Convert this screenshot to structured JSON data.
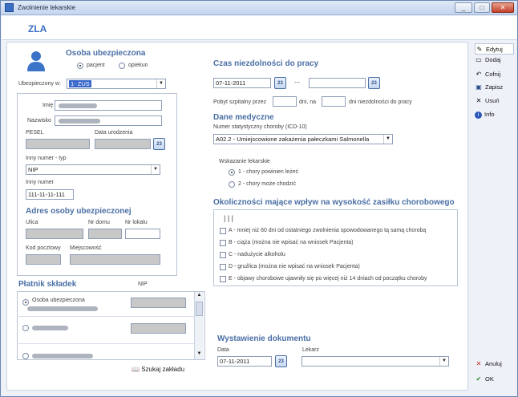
{
  "window": {
    "title": "Zwolnienie lekarskie",
    "controls": {
      "minimize": "_",
      "maximize": "□",
      "close": "✕"
    }
  },
  "header": {
    "title": "ZLA"
  },
  "insured": {
    "section_title": "Osoba ubezpieczona",
    "radio_patient": "pacjent",
    "radio_guardian": "opiekun",
    "insured_in_label": "Ubezpieczony w:",
    "insured_in_value": "1- ZUS",
    "first_name_label": "Imię",
    "last_name_label": "Nazwisko",
    "pesel_label": "PESEL",
    "birth_date_label": "Data urodzenia",
    "other_number_type_label": "Inny numer - typ",
    "other_number_type_value": "NIP",
    "other_number_label": "Inny numer",
    "other_number_value": "111-11-11-111"
  },
  "address": {
    "section_title": "Adres osoby ubezpieczonej",
    "street_label": "Ulica",
    "house_label": "Nr domu",
    "flat_label": "Nr lokalu",
    "postcode_label": "Kod pocztowy",
    "city_label": "Miejscowość"
  },
  "payer": {
    "section_title": "Płatnik składek",
    "nip_label": "NIP",
    "option1": "Osoba ubezpieczona",
    "search_button": "Szukaj zakładu"
  },
  "incapacity": {
    "section_title": "Czas niezdolności do pracy",
    "date_from": "07-11-2011",
    "separator": "---",
    "hospital_label": "Pobyt szpitalny przez",
    "days_label": "dni, na",
    "days_incapacity_label": "dni niezdolności do pracy"
  },
  "medical": {
    "section_title": "Dane medyczne",
    "icd_label": "Numer statystyczny choroby (ICD-10)",
    "icd_value": "A02.2 - Umiejscowione zakażenia pałeczkami Salmonella",
    "indication_label": "Wskazanie lekarskie",
    "indication1": "1 - chory powinien leżeć",
    "indication2": "2 - chory może chodzić"
  },
  "circumstances": {
    "section_title": "Okoliczności mające wpływ na wysokość zasiłku chorobowego",
    "codes": "| | |",
    "items": [
      "A - mniej niż 60 dni od ostatniego zwolnienia spowodowanego tą samą chorobą",
      "B - ciąża (można nie wpisać na wniosek Pacjenta)",
      "C - nadużycie alkoholu",
      "D - gruźlica (można nie wpisać na wniosek Pacjenta)",
      "E - objawy chorobowe ujawniły się po więcej niż 14 dniach od początku choroby"
    ]
  },
  "issue": {
    "section_title": "Wystawienie dokumentu",
    "date_label": "Data",
    "date_value": "07-11-2011",
    "doctor_label": "Lekarz"
  },
  "calendar_label": "23",
  "sidebar": {
    "edit": "Edytuj",
    "add": "Dodaj",
    "undo": "Cofnij",
    "save": "Zapisz",
    "delete": "Usuń",
    "info": "Info",
    "cancel": "Anuluj",
    "ok": "OK"
  }
}
